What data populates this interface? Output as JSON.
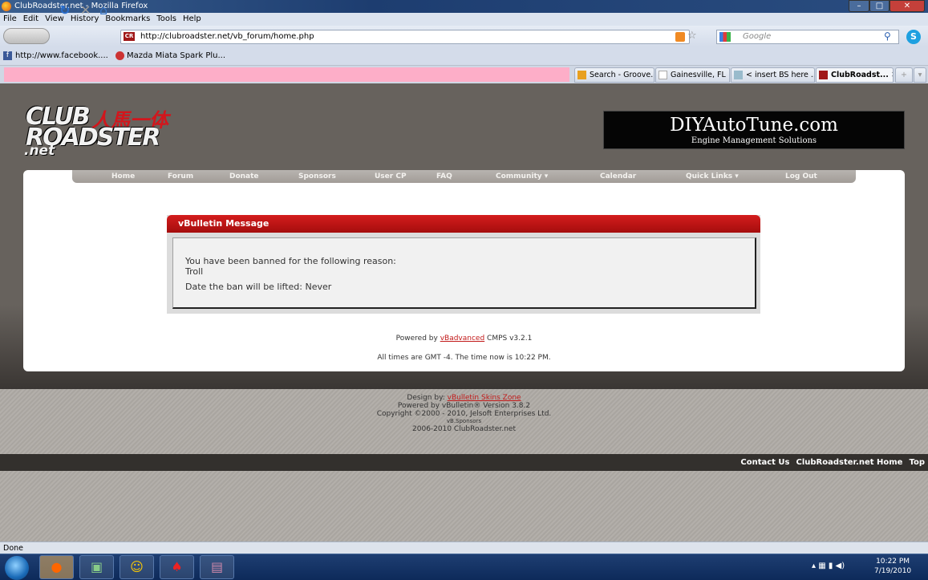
{
  "window": {
    "title": "ClubRoadster.net - Mozilla Firefox",
    "min": "–",
    "max": "□",
    "close": "✕"
  },
  "menu": [
    "File",
    "Edit",
    "View",
    "History",
    "Bookmarks",
    "Tools",
    "Help"
  ],
  "toolbar": {
    "url": "http://clubroadster.net/vb_forum/home.php",
    "search_placeholder": "Google",
    "favicon": "CR"
  },
  "bookmarks": [
    "http://www.facebook....",
    "Mazda Miata Spark Plu..."
  ],
  "tabs": [
    {
      "label": "Search - Groove..."
    },
    {
      "label": "Gainesville, FL | ..."
    },
    {
      "label": "< insert BS here ..."
    },
    {
      "label": "ClubRoadst...",
      "active": true
    }
  ],
  "site": {
    "logo": {
      "line1": "CLUB",
      "kanji": "人馬一体",
      "line2": "ROADSTER",
      "net": ".net"
    },
    "ad": {
      "title": "DIYAutoTune.com",
      "subtitle": "Engine Management Solutions"
    },
    "nav": [
      "Home",
      "Forum",
      "Donate",
      "Sponsors",
      "User CP",
      "FAQ",
      "Community ▾",
      "Calendar",
      "Quick Links ▾",
      "Log Out"
    ],
    "message": {
      "title": "vBulletin Message",
      "line1": "You have been banned for the following reason:",
      "reason": "Troll",
      "line2": "Date the ban will be lifted: Never"
    },
    "powered": {
      "prefix": "Powered by ",
      "link": "vBadvanced",
      "suffix": " CMPS v3.2.1"
    },
    "times": "All times are GMT -4. The time now is 10:22 PM.",
    "footer": {
      "design_prefix": "Design by: ",
      "design_link": "vBulletin Skins Zone",
      "powered": "Powered by vBulletin® Version 3.8.2",
      "copyright": "Copyright ©2000 - 2010, Jelsoft Enterprises Ltd.",
      "sponsors": "vB.Sponsors",
      "site": "2006-2010 ClubRoadster.net"
    },
    "bottom_links": [
      "Contact Us",
      "ClubRoadster.net Home",
      "Top"
    ]
  },
  "status": "Done",
  "clock": {
    "time": "10:22 PM",
    "date": "7/19/2010"
  }
}
